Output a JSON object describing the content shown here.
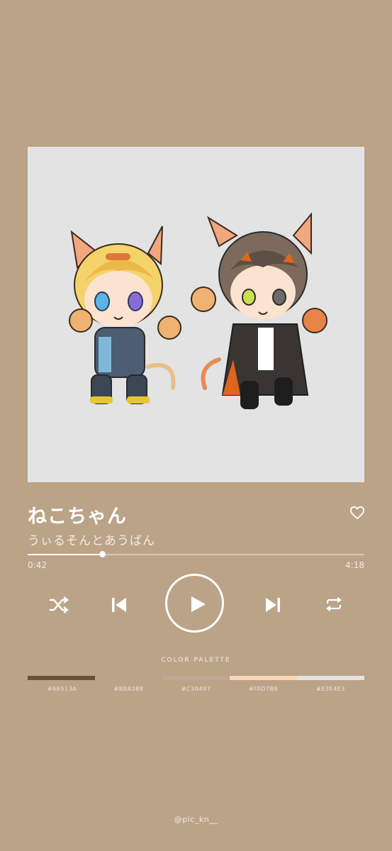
{
  "song": {
    "title": "ねこちゃん",
    "artist": "うぃるそんとあうばん"
  },
  "player": {
    "current_time": "0:42",
    "total_time": "4:18",
    "progress_fraction": 0.222
  },
  "controls": {
    "favorite_icon": "heart-outline-icon",
    "shuffle_icon": "shuffle-icon",
    "previous_icon": "skip-previous-icon",
    "play_icon": "play-icon",
    "next_icon": "skip-next-icon",
    "repeat_icon": "repeat-icon"
  },
  "palette": {
    "title": "COLOR PALETTE",
    "colors": [
      {
        "hex": "#66513A",
        "label": "#66513A"
      },
      {
        "hex": "#BBA388",
        "label": "#BBA388"
      },
      {
        "hex": "#C3A497",
        "label": "#C3A497"
      },
      {
        "hex": "#FAD7B8",
        "label": "#FAD7B8"
      },
      {
        "hex": "#E3E4E3",
        "label": "#E3E4E3"
      }
    ]
  },
  "credit": "@pic_kn__",
  "colors": {
    "background": "#BBA388",
    "text": "#FFFFFF",
    "artwork_background": "#E3E3E3"
  },
  "artwork": "two chibi characters with cat ears and cat paws on a light gray background"
}
